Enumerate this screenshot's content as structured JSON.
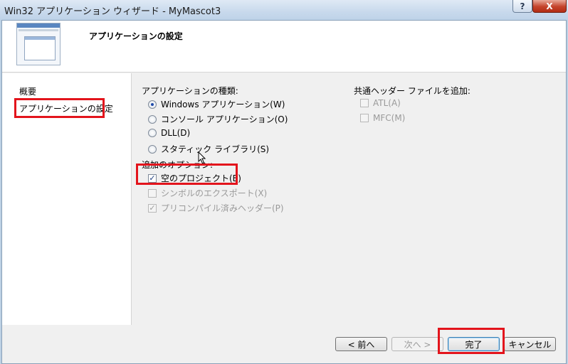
{
  "window": {
    "title": "Win32 アプリケーション ウィザード - MyMascot3",
    "help_label": "?",
    "close_label": "X"
  },
  "header": {
    "title": "アプリケーションの設定"
  },
  "nav": {
    "items": [
      {
        "label": "概要"
      },
      {
        "label": "アプリケーションの設定"
      }
    ]
  },
  "app_type": {
    "label": "アプリケーションの種類:",
    "options": [
      {
        "label": "Windows アプリケーション(W)",
        "checked": true
      },
      {
        "label": "コンソール アプリケーション(O)",
        "checked": false
      },
      {
        "label": "DLL(D)",
        "checked": false
      },
      {
        "label": "スタティック ライブラリ(S)",
        "checked": false
      }
    ]
  },
  "additional": {
    "label": "追加のオプション:",
    "options": [
      {
        "label": "空のプロジェクト(E)",
        "checked": true,
        "enabled": true
      },
      {
        "label": "シンボルのエクスポート(X)",
        "checked": false,
        "enabled": false
      },
      {
        "label": "プリコンパイル済みヘッダー(P)",
        "checked": true,
        "enabled": false
      }
    ]
  },
  "common_headers": {
    "label": "共通ヘッダー ファイルを追加:",
    "options": [
      {
        "label": "ATL(A)",
        "checked": false,
        "enabled": false
      },
      {
        "label": "MFC(M)",
        "checked": false,
        "enabled": false
      }
    ]
  },
  "buttons": {
    "prev": "< 前へ",
    "next": "次へ >",
    "finish": "完了",
    "cancel": "キャンセル"
  },
  "colors": {
    "annotation": "#e3141c",
    "radio_dot": "#1f4aa8"
  },
  "check_mark": "✓"
}
